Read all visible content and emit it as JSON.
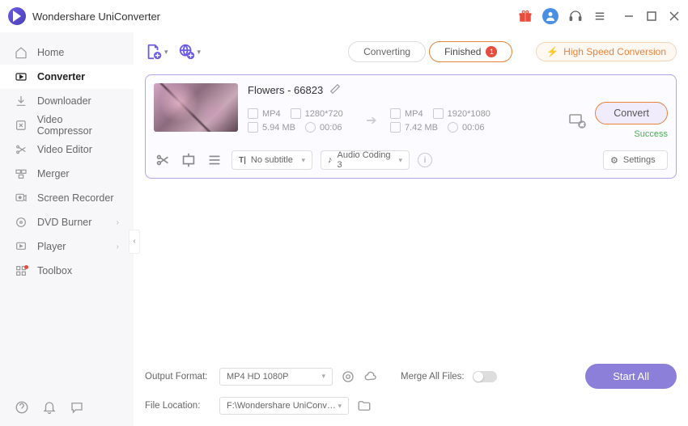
{
  "app_title": "Wondershare UniConverter",
  "sidebar": {
    "items": [
      {
        "label": "Home",
        "icon": "home"
      },
      {
        "label": "Converter",
        "icon": "converter",
        "active": true
      },
      {
        "label": "Downloader",
        "icon": "downloader"
      },
      {
        "label": "Video Compressor",
        "icon": "compressor"
      },
      {
        "label": "Video Editor",
        "icon": "editor"
      },
      {
        "label": "Merger",
        "icon": "merger"
      },
      {
        "label": "Screen Recorder",
        "icon": "recorder"
      },
      {
        "label": "DVD Burner",
        "icon": "dvd",
        "chevron": true
      },
      {
        "label": "Player",
        "icon": "player",
        "chevron": true
      },
      {
        "label": "Toolbox",
        "icon": "toolbox",
        "dot": true
      }
    ]
  },
  "tabs": {
    "converting": "Converting",
    "finished": "Finished",
    "finished_count": "1"
  },
  "hsc_label": "High Speed Conversion",
  "file": {
    "name": "Flowers - 66823",
    "src": {
      "format": "MP4",
      "resolution": "1280*720",
      "size": "5.94 MB",
      "duration": "00:06"
    },
    "dst": {
      "format": "MP4",
      "resolution": "1920*1080",
      "size": "7.42 MB",
      "duration": "00:06"
    },
    "convert_label": "Convert",
    "status": "Success",
    "subtitle": "No subtitle",
    "audio": "Audio Coding 3",
    "settings_label": "Settings"
  },
  "footer": {
    "output_format_label": "Output Format:",
    "output_format_value": "MP4 HD 1080P",
    "file_location_label": "File Location:",
    "file_location_value": "F:\\Wondershare UniConverter",
    "merge_label": "Merge All Files:",
    "start_all": "Start All"
  }
}
